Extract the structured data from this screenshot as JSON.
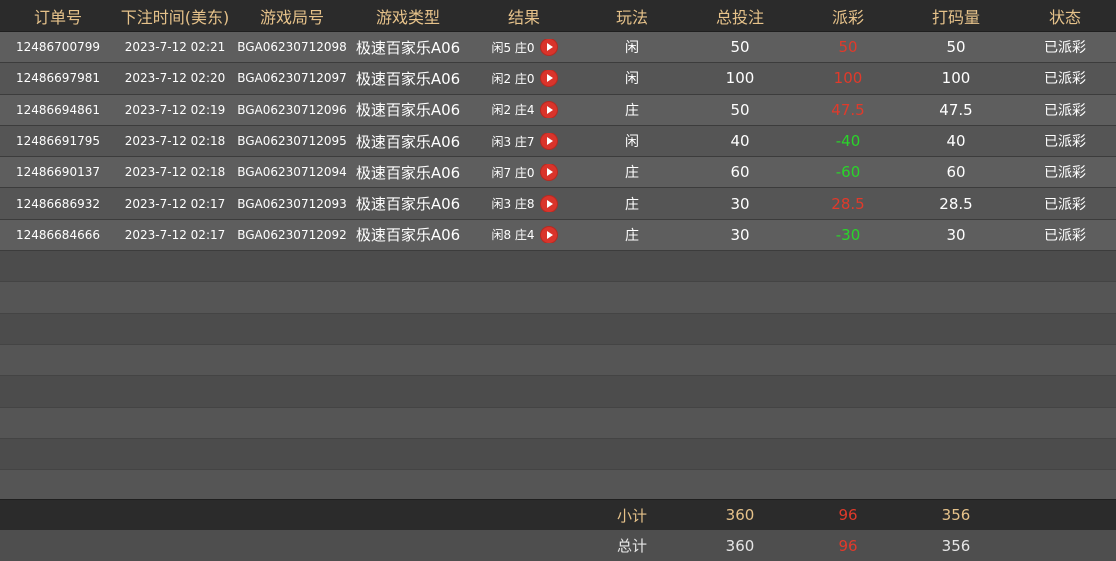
{
  "headers": [
    "订单号",
    "下注时间(美东)",
    "游戏局号",
    "游戏类型",
    "结果",
    "玩法",
    "总投注",
    "派彩",
    "打码量",
    "状态"
  ],
  "rows": [
    {
      "order_id": "12486700799",
      "bet_time": "2023-7-12 02:21",
      "round_id": "BGA06230712098",
      "game_type": "极速百家乐A06",
      "result": "闲5 庄0",
      "play": "闲",
      "total_bet": "50",
      "payout": "50",
      "payout_sign": "positive",
      "valid_bet": "50",
      "status": "已派彩"
    },
    {
      "order_id": "12486697981",
      "bet_time": "2023-7-12 02:20",
      "round_id": "BGA06230712097",
      "game_type": "极速百家乐A06",
      "result": "闲2 庄0",
      "play": "闲",
      "total_bet": "100",
      "payout": "100",
      "payout_sign": "positive",
      "valid_bet": "100",
      "status": "已派彩"
    },
    {
      "order_id": "12486694861",
      "bet_time": "2023-7-12 02:19",
      "round_id": "BGA06230712096",
      "game_type": "极速百家乐A06",
      "result": "闲2 庄4",
      "play": "庄",
      "total_bet": "50",
      "payout": "47.5",
      "payout_sign": "positive",
      "valid_bet": "47.5",
      "status": "已派彩"
    },
    {
      "order_id": "12486691795",
      "bet_time": "2023-7-12 02:18",
      "round_id": "BGA06230712095",
      "game_type": "极速百家乐A06",
      "result": "闲3 庄7",
      "play": "闲",
      "total_bet": "40",
      "payout": "-40",
      "payout_sign": "negative",
      "valid_bet": "40",
      "status": "已派彩"
    },
    {
      "order_id": "12486690137",
      "bet_time": "2023-7-12 02:18",
      "round_id": "BGA06230712094",
      "game_type": "极速百家乐A06",
      "result": "闲7 庄0",
      "play": "庄",
      "total_bet": "60",
      "payout": "-60",
      "payout_sign": "negative",
      "valid_bet": "60",
      "status": "已派彩"
    },
    {
      "order_id": "12486686932",
      "bet_time": "2023-7-12 02:17",
      "round_id": "BGA06230712093",
      "game_type": "极速百家乐A06",
      "result": "闲3 庄8",
      "play": "庄",
      "total_bet": "30",
      "payout": "28.5",
      "payout_sign": "positive",
      "valid_bet": "28.5",
      "status": "已派彩"
    },
    {
      "order_id": "12486684666",
      "bet_time": "2023-7-12 02:17",
      "round_id": "BGA06230712092",
      "game_type": "极速百家乐A06",
      "result": "闲8 庄4",
      "play": "庄",
      "total_bet": "30",
      "payout": "-30",
      "payout_sign": "negative",
      "valid_bet": "30",
      "status": "已派彩"
    }
  ],
  "subtotal": {
    "label": "小计",
    "total_bet": "360",
    "payout": "96",
    "valid_bet": "356"
  },
  "total": {
    "label": "总计",
    "total_bet": "360",
    "payout": "96",
    "valid_bet": "356"
  },
  "colors": {
    "header_text": "#e6c28a",
    "payout_positive": "#e03a2b",
    "payout_negative": "#2ad42a",
    "play_icon": "#d9342b"
  },
  "icons": {
    "replay": "play-circle-icon"
  }
}
